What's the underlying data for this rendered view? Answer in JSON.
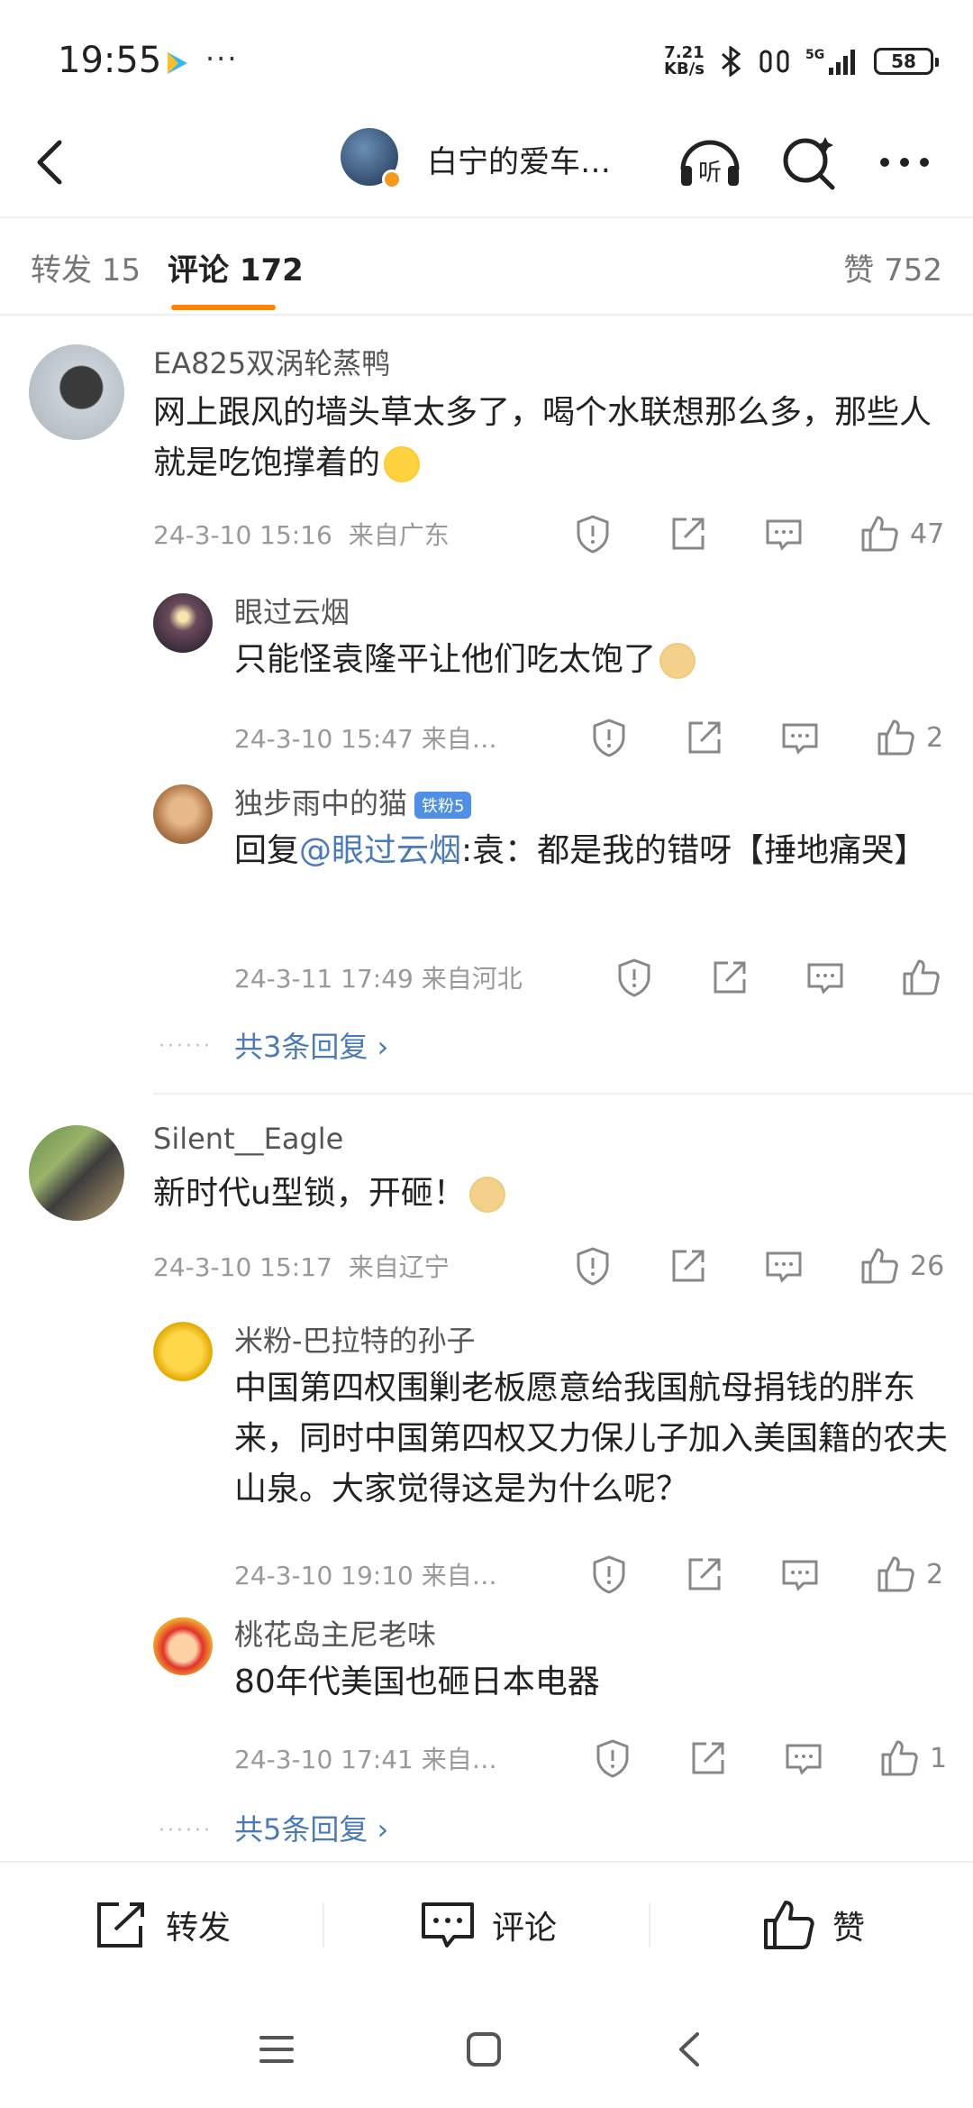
{
  "status_bar": {
    "time": "19:55",
    "net_speed_value": "7.21",
    "net_speed_unit": "KB/s",
    "network": "5G",
    "battery": "58"
  },
  "header": {
    "title": "白宁的爱车…",
    "listen_label": "听"
  },
  "tabs": {
    "repost": "转发 15",
    "comment": "评论 172",
    "like": "赞 752"
  },
  "comments": [
    {
      "user": "EA825双涡轮蒸鸭",
      "text": "网上跟风的墙头草太多了，喝个水联想那么多，那些人就是吃饱撑着的",
      "time": "24-3-10 15:16",
      "location": "来自广东",
      "likes": "47",
      "replies": [
        {
          "user": "眼过云烟",
          "text": "只能怪袁隆平让他们吃太饱了",
          "meta": "24-3-10 15:47  来自…",
          "likes": "2"
        },
        {
          "user": "独步雨中的猫",
          "badge": "铁粉5",
          "reply_prefix": "回复",
          "mention": "@眼过云烟",
          "text": ":袁：都是我的错呀【捶地痛哭】",
          "meta": "24-3-11 17:49  来自河北",
          "likes": ""
        }
      ],
      "more_replies": "共3条回复 ›"
    },
    {
      "user": "Silent__Eagle",
      "text": "新时代u型锁，开砸！",
      "time": "24-3-10 15:17",
      "location": "来自辽宁",
      "likes": "26",
      "replies": [
        {
          "user": "米粉-巴拉特的孙子",
          "text": "中国第四权围剿老板愿意给我国航母捐钱的胖东来，同时中国第四权又力保儿子加入美国籍的农夫山泉。大家觉得这是为什么呢？",
          "meta": "24-3-10 19:10  来自…",
          "likes": "2"
        },
        {
          "user": "桃花岛主尼老味",
          "text": "80年代美国也砸日本电器",
          "meta": "24-3-10 17:41  来自…",
          "likes": "1"
        }
      ],
      "more_replies": "共5条回复 ›"
    }
  ],
  "bottom_bar": {
    "repost": "转发",
    "comment": "评论",
    "like": "赞"
  },
  "icons": {
    "action": [
      "report-icon",
      "share-icon",
      "reply-icon",
      "like-icon"
    ],
    "accent": "#ff8200",
    "link": "#4b7bb6"
  }
}
